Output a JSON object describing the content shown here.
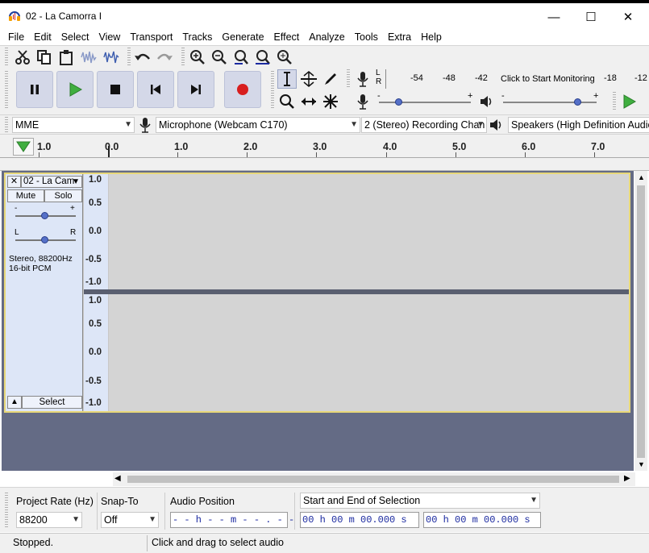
{
  "window": {
    "title": "02 - La Camorra I",
    "minimize": "—",
    "maximize": "☐",
    "close": "✕"
  },
  "menu": [
    "File",
    "Edit",
    "Select",
    "View",
    "Transport",
    "Tracks",
    "Generate",
    "Effect",
    "Analyze",
    "Tools",
    "Extra",
    "Help"
  ],
  "meters": {
    "record_channels": [
      "L",
      "R"
    ],
    "record_scale": [
      "-54",
      "-48",
      "-42",
      "-18",
      "-12"
    ],
    "monitor_prompt": "Click to Start Monitoring",
    "slider_minus": "-",
    "slider_plus": "+"
  },
  "device": {
    "host": "MME",
    "input": "Microphone (Webcam C170)",
    "channels": "2 (Stereo) Recording Chan",
    "output": "Speakers (High Definition Audio"
  },
  "ruler": {
    "ticks": [
      "1.0",
      "0.0",
      "1.0",
      "2.0",
      "3.0",
      "4.0",
      "5.0",
      "6.0",
      "7.0"
    ]
  },
  "track": {
    "name": "02 - La Cam",
    "mute": "Mute",
    "solo": "Solo",
    "gain_minus": "-",
    "gain_plus": "+",
    "pan_left": "L",
    "pan_right": "R",
    "info_line1": "Stereo, 88200Hz",
    "info_line2": "16-bit PCM",
    "select": "Select",
    "scale": [
      "1.0",
      "0.5",
      "0.0",
      "-0.5",
      "-1.0"
    ]
  },
  "selection_bar": {
    "project_rate_label": "Project Rate (Hz)",
    "project_rate": "88200",
    "snap_label": "Snap-To",
    "snap_value": "Off",
    "audio_position_label": "Audio Position",
    "audio_position": "- - h - - m - - . - - - s",
    "selection_mode": "Start and End of Selection",
    "start_time": "00 h 00 m 00.000 s",
    "end_time": "00 h 00 m 00.000 s"
  },
  "status": {
    "state": "Stopped.",
    "hint": "Click and drag to select audio"
  },
  "colors": {
    "track_bg": "#646b85",
    "track_panel": "#dde6f7",
    "track_border": "#e8d878",
    "transport": "#d4d8e8",
    "play_green": "#3fae3f",
    "record_red": "#d81e1e",
    "time_text": "#1b2aa0"
  }
}
